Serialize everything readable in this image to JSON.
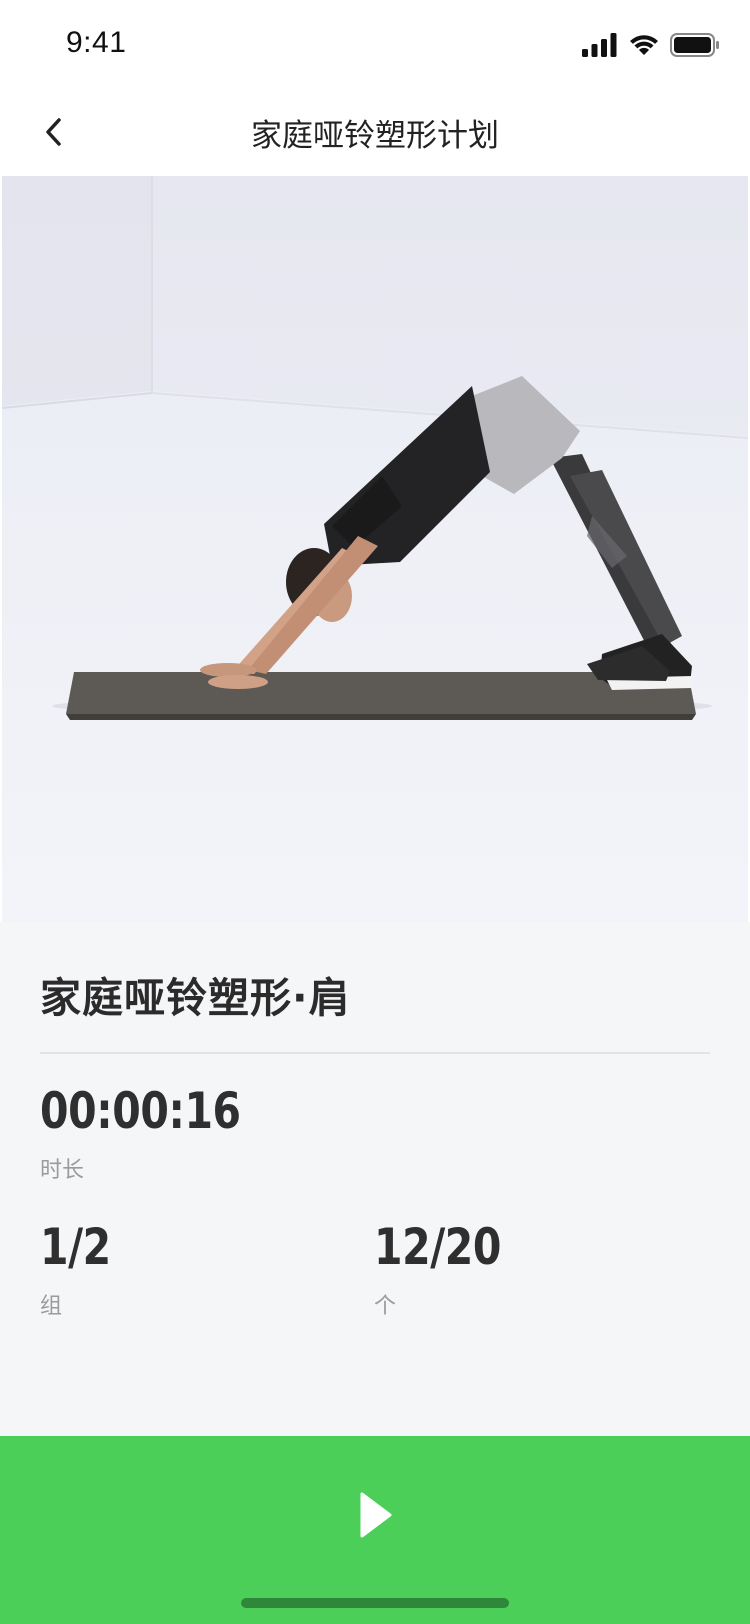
{
  "status_bar": {
    "time": "9:41",
    "icons": [
      "signal-icon",
      "wifi-icon",
      "battery-icon"
    ]
  },
  "nav": {
    "back_icon": "chevron-left-icon",
    "title": "家庭哑铃塑形计划"
  },
  "hero": {
    "image": "workout-illustration-downward-dog"
  },
  "exercise": {
    "name": "家庭哑铃塑形·肩",
    "duration_value": "00:00:16",
    "duration_label": "时长",
    "sets_value": "1/2",
    "sets_label": "组",
    "reps_value": "12/20",
    "reps_label": "个"
  },
  "controls": {
    "play_icon": "play-icon"
  },
  "colors": {
    "accent_green": "#4ccf58",
    "panel_bg": "#f5f6f8",
    "text_dark": "#2b2b2b",
    "text_muted": "#9b9b9b"
  }
}
